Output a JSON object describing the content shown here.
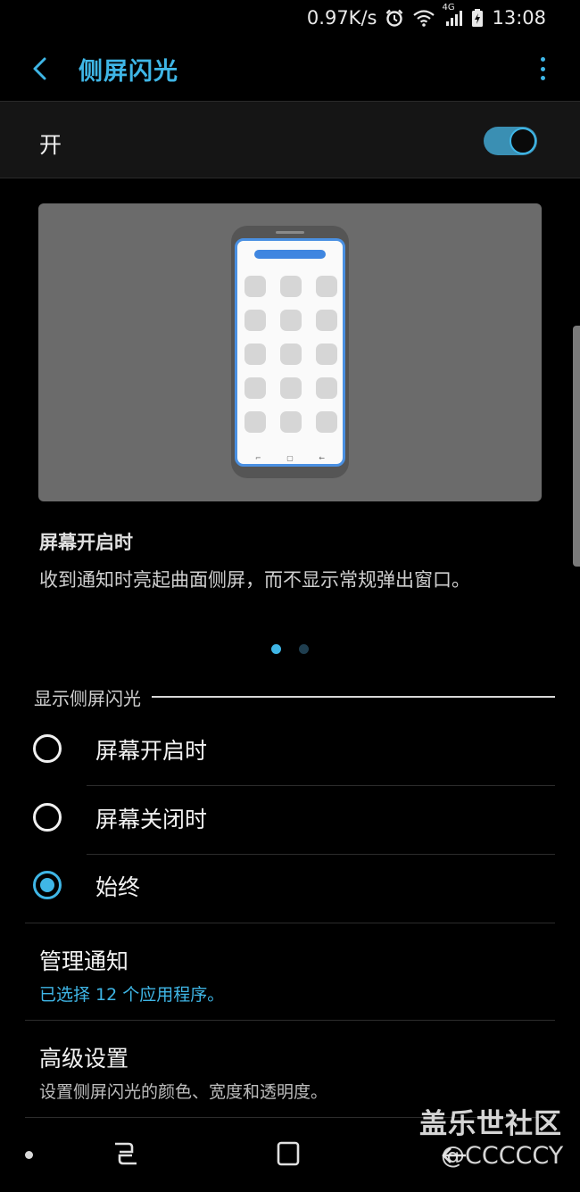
{
  "status_bar": {
    "net_speed": "0.97K/s",
    "network_type": "4G",
    "time": "13:08",
    "icons": [
      "alarm-icon",
      "wifi-icon",
      "signal-icon",
      "battery-charging-icon"
    ]
  },
  "header": {
    "back_icon": "chevron-left-icon",
    "title": "侧屏闪光",
    "more_icon": "more-vertical-icon"
  },
  "master_switch": {
    "label": "开",
    "enabled": true,
    "accent": "#3fb6e6"
  },
  "preview": {
    "page_count": 2,
    "current_page": 1
  },
  "description": {
    "title": "屏幕开启时",
    "text": "收到通知时亮起曲面侧屏，而不显示常规弹出窗口。"
  },
  "section": {
    "title": "显示侧屏闪光"
  },
  "options": [
    {
      "label": "屏幕开启时",
      "selected": false
    },
    {
      "label": "屏幕关闭时",
      "selected": false
    },
    {
      "label": "始终",
      "selected": true
    }
  ],
  "manage": {
    "title": "管理通知",
    "subtitle": "已选择 12 个应用程序。"
  },
  "advanced": {
    "title": "高级设置",
    "subtitle": "设置侧屏闪光的颜色、宽度和透明度。"
  },
  "watermark": {
    "line1": "盖乐世社区",
    "line2": "@CCCCCY"
  },
  "colors": {
    "accent": "#3fb6e6",
    "background": "#000000"
  }
}
